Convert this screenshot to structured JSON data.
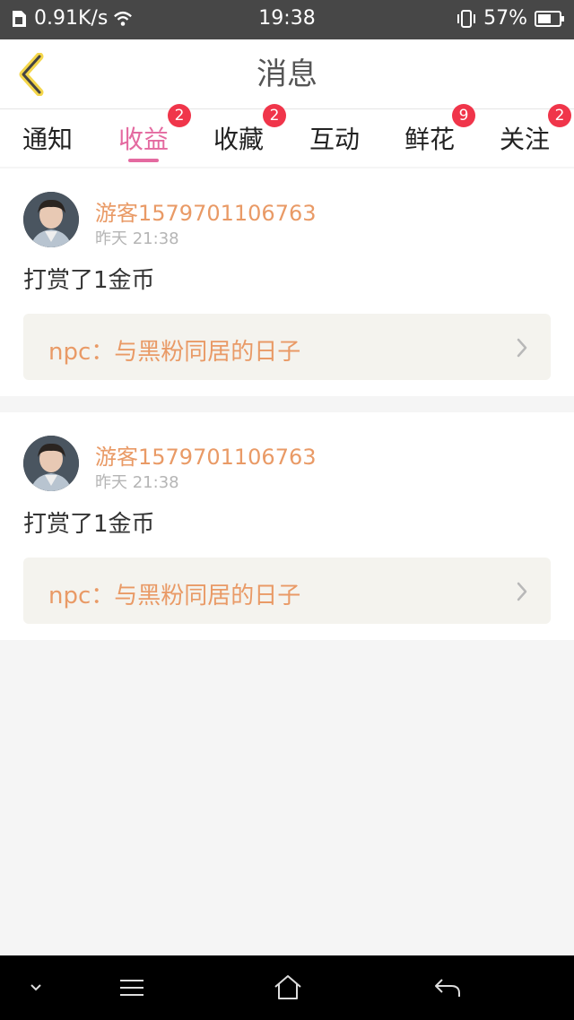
{
  "status_bar": {
    "net_speed": "0.91K/s",
    "time": "19:38",
    "battery": "57%"
  },
  "header": {
    "title": "消息"
  },
  "tabs": [
    {
      "label": "通知",
      "badge": ""
    },
    {
      "label": "收益",
      "badge": "2",
      "active": true
    },
    {
      "label": "收藏",
      "badge": "2"
    },
    {
      "label": "互动",
      "badge": ""
    },
    {
      "label": "鲜花",
      "badge": "9"
    },
    {
      "label": "关注",
      "badge": "2"
    }
  ],
  "messages": [
    {
      "username": "游客1579701106763",
      "time": "昨天 21:38",
      "text": "打赏了1金币",
      "link": "npc：与黑粉同居的日子"
    },
    {
      "username": "游客1579701106763",
      "time": "昨天 21:38",
      "text": "打赏了1金币",
      "link": "npc：与黑粉同居的日子"
    }
  ],
  "colors": {
    "accent": "#e46aa0",
    "username": "#e99a66",
    "badge": "#f0354a",
    "status_bar": "#474747"
  }
}
